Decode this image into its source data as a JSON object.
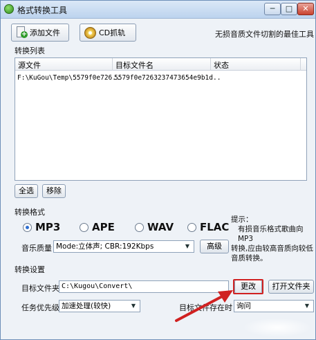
{
  "window": {
    "title": "格式转换工具",
    "min_label": "─",
    "max_label": "□",
    "close_label": "✕"
  },
  "toolbar": {
    "add_file_label": "添加文件",
    "cd_rip_label": "CD抓轨",
    "slogan": "无损音质文件切割的最佳工具"
  },
  "convert_list": {
    "group_label": "转换列表",
    "columns": [
      "源文件",
      "目标文件名",
      "状态"
    ],
    "rows": [
      {
        "source": "F:\\KuGou\\Temp\\5579f0e726..",
        "target": "5579f0e7263237473654e9b1d..",
        "status": ""
      }
    ]
  },
  "list_buttons": {
    "select_all": "全选",
    "remove": "移除"
  },
  "format": {
    "group_label": "转换格式",
    "options": [
      "MP3",
      "APE",
      "WAV",
      "FLAC"
    ],
    "selected": "MP3",
    "quality_label": "音乐质量",
    "quality_value": "Mode:立体声; CBR:192Kbps",
    "advanced_label": "高级",
    "hint_lines": [
      "提示：",
      "有损音乐格式歌曲向MP3",
      "转换,应由较高音质向较低",
      "音质转换。"
    ]
  },
  "settings": {
    "group_label": "转换设置",
    "target_folder_label": "目标文件夹",
    "target_folder_value": "C:\\Kugou\\Convert\\",
    "change_label": "更改",
    "open_folder_label": "打开文件夹",
    "priority_label": "任务优先级",
    "priority_value": "加速处理(较快)",
    "exists_label": "目标文件存在时",
    "exists_value": "询问"
  },
  "colors": {
    "accent_red": "#d02121",
    "window_border": "#6d8fb8",
    "radio_selected": "#2f6fd0"
  }
}
